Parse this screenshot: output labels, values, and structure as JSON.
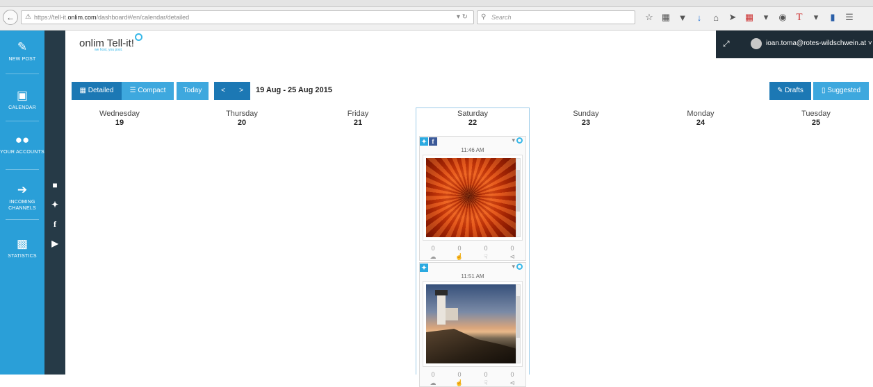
{
  "browser": {
    "url_prefix": "https://tell-it.",
    "url_host": "onlim.com",
    "url_path": "/dashboard#/en/calendar/detailed",
    "search_placeholder": "Search"
  },
  "sidebar": {
    "items": [
      {
        "label": "NEW POST",
        "icon": "pencil-square-icon"
      },
      {
        "label": "CALENDAR",
        "icon": "calendar-icon"
      },
      {
        "label": "YOUR ACCOUNTS",
        "icon": "users-icon"
      },
      {
        "label": "INCOMING CHANNELS",
        "icon": "sign-in-icon"
      },
      {
        "label": "STATISTICS",
        "icon": "bar-chart-icon"
      }
    ]
  },
  "social_strip": [
    "buffer-icon",
    "twitter-icon",
    "facebook-icon",
    "youtube-icon"
  ],
  "header": {
    "logo_text": "onlim Tell-it!",
    "tagline": "we host, you post.",
    "user_email": "ioan.toma@rotes-wildschwein.at"
  },
  "toolbar": {
    "detailed_label": "Detailed",
    "compact_label": "Compact",
    "today_label": "Today",
    "prev_label": "<",
    "next_label": ">",
    "date_range": "19 Aug - 25 Aug 2015",
    "drafts_label": "Drafts",
    "suggested_label": "Suggested"
  },
  "calendar": {
    "days": [
      {
        "name": "Wednesday",
        "num": "19"
      },
      {
        "name": "Thursday",
        "num": "20"
      },
      {
        "name": "Friday",
        "num": "21"
      },
      {
        "name": "Saturday",
        "num": "22"
      },
      {
        "name": "Sunday",
        "num": "23"
      },
      {
        "name": "Monday",
        "num": "24"
      },
      {
        "name": "Tuesday",
        "num": "25"
      }
    ],
    "posts": [
      {
        "time": "11:46 AM",
        "networks": [
          "twitter",
          "facebook"
        ],
        "image": "red chrysanthemum flower",
        "stats": [
          "0",
          "0",
          "0",
          "0"
        ]
      },
      {
        "time": "11:51 AM",
        "networks": [
          "twitter"
        ],
        "image": "lighthouse at sunset",
        "stats": [
          "0",
          "0",
          "0",
          "0"
        ]
      }
    ]
  },
  "colors": {
    "sidebar": "#2a9fd8",
    "social_strip": "#263a47",
    "user_panel": "#1e2c36",
    "button_dark": "#1c78b4",
    "button_light": "#3ea8de"
  }
}
